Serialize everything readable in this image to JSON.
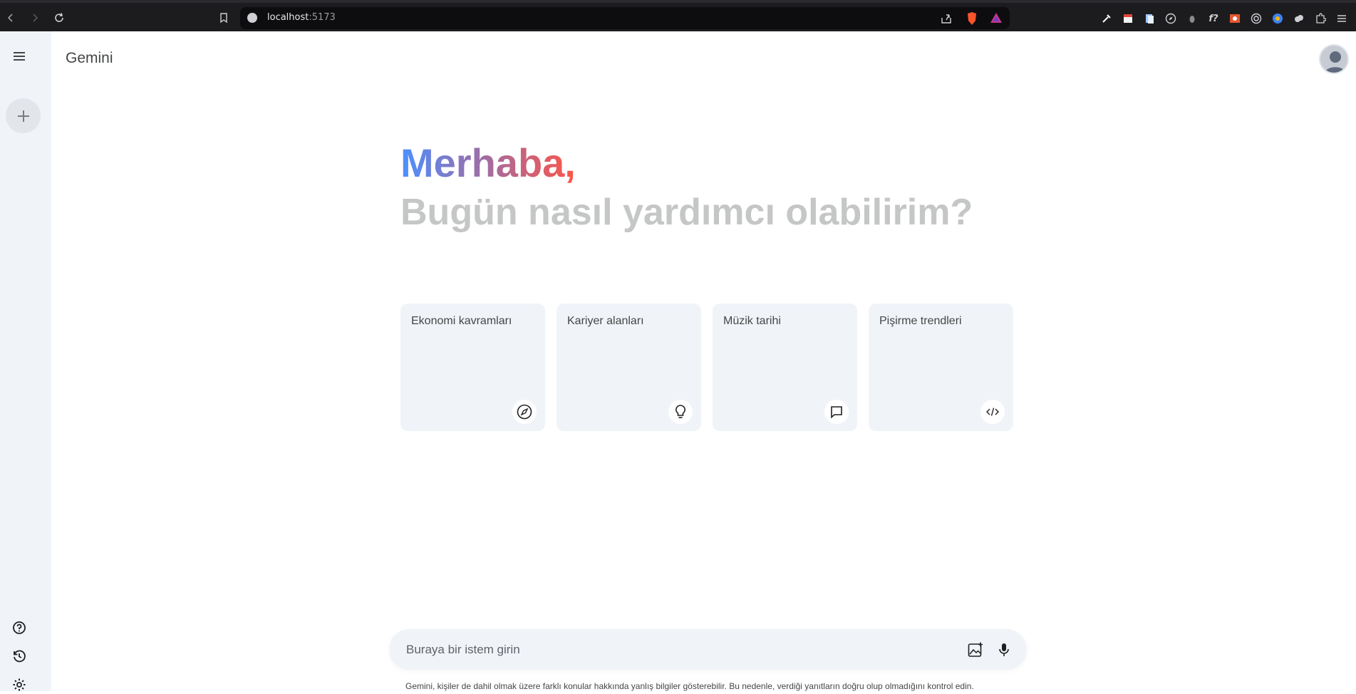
{
  "browser": {
    "url_host": "localhost",
    "url_port": ":5173",
    "extension_f": "f?"
  },
  "app": {
    "title": "Gemini"
  },
  "greeting": {
    "hello": "Merhaba,",
    "question": "Bugün nasıl yardımcı olabilirim?"
  },
  "cards": [
    {
      "label": "Ekonomi kavramları",
      "icon": "compass-icon"
    },
    {
      "label": "Kariyer alanları",
      "icon": "bulb-icon"
    },
    {
      "label": "Müzik tarihi",
      "icon": "message-icon"
    },
    {
      "label": "Pişirme trendleri",
      "icon": "code-icon"
    }
  ],
  "prompt": {
    "placeholder": "Buraya bir istem girin"
  },
  "footer": {
    "disclaimer": "Gemini, kişiler de dahil olmak üzere farklı konular hakkında yanlış bilgiler gösterebilir. Bu nedenle, verdiği yanıtların doğru olup olmadığını kontrol edin."
  },
  "colors": {
    "sidebar_bg": "#f0f4f9",
    "card_bg": "#f0f4f9",
    "gradient_start": "#4b90ff",
    "gradient_end": "#ff5546",
    "subtitle": "#c4c7c5"
  }
}
